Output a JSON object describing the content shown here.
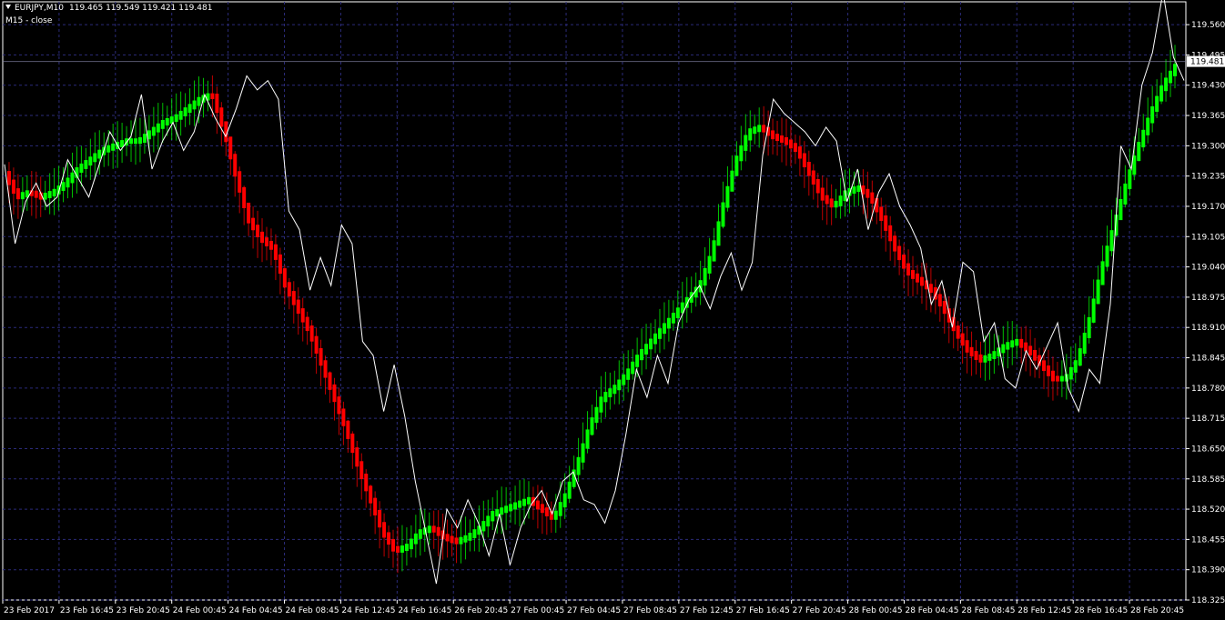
{
  "header": {
    "symbol": "EURJPY,M10",
    "quote": "119.465 119.549 119.421 119.481",
    "indicator": "M15 - close"
  },
  "colors": {
    "background": "#000000",
    "grid": "#2b2b7a",
    "axis": "#ffffff",
    "price_line": "#ffffff",
    "up": "#00ff00",
    "down": "#ff0000",
    "current_price_bg": "#ffffff",
    "current_price_text": "#000000"
  },
  "chart_data": {
    "type": "line",
    "grid": true,
    "current_price": "119.481",
    "ylim": [
      118.325,
      119.609
    ],
    "y_ticks": [
      "119.560",
      "119.495",
      "119.430",
      "119.365",
      "119.300",
      "119.235",
      "119.170",
      "119.105",
      "119.040",
      "118.975",
      "118.910",
      "118.845",
      "118.780",
      "118.715",
      "118.650",
      "118.585",
      "118.520",
      "118.455",
      "118.390",
      "118.325"
    ],
    "x_ticks": [
      "23 Feb 2017",
      "23 Feb 16:45",
      "23 Feb 20:45",
      "24 Feb 00:45",
      "24 Feb 04:45",
      "24 Feb 08:45",
      "24 Feb 12:45",
      "24 Feb 16:45",
      "26 Feb 20:45",
      "27 Feb 00:45",
      "27 Feb 04:45",
      "27 Feb 08:45",
      "27 Feb 12:45",
      "27 Feb 16:45",
      "27 Feb 20:45",
      "28 Feb 00:45",
      "28 Feb 04:45",
      "28 Feb 08:45",
      "28 Feb 12:45",
      "28 Feb 16:45",
      "28 Feb 20:45"
    ],
    "series": [
      {
        "role": "close",
        "values": [
          119.26,
          119.09,
          119.18,
          119.22,
          119.17,
          119.19,
          119.27,
          119.23,
          119.19,
          119.26,
          119.33,
          119.29,
          119.32,
          119.41,
          119.25,
          119.31,
          119.35,
          119.29,
          119.33,
          119.41,
          119.36,
          119.32,
          119.38,
          119.45,
          119.42,
          119.44,
          119.4,
          119.16,
          119.12,
          118.99,
          119.06,
          119.0,
          119.13,
          119.09,
          118.88,
          118.85,
          118.73,
          118.83,
          118.72,
          118.58,
          118.47,
          118.36,
          118.52,
          118.48,
          118.54,
          118.49,
          118.42,
          118.51,
          118.4,
          118.48,
          118.53,
          118.56,
          118.51,
          118.58,
          118.6,
          118.54,
          118.53,
          118.49,
          118.56,
          118.68,
          118.82,
          118.76,
          118.85,
          118.79,
          118.92,
          118.97,
          119.0,
          118.95,
          119.02,
          119.07,
          118.99,
          119.05,
          119.28,
          119.4,
          119.37,
          119.35,
          119.33,
          119.3,
          119.34,
          119.31,
          119.18,
          119.25,
          119.12,
          119.2,
          119.24,
          119.17,
          119.13,
          119.08,
          118.96,
          119.01,
          118.91,
          119.05,
          119.03,
          118.88,
          118.92,
          118.8,
          118.78,
          118.86,
          118.82,
          118.87,
          118.92,
          118.78,
          118.73,
          118.82,
          118.79,
          118.96,
          119.3,
          119.25,
          119.43,
          119.5,
          119.63,
          119.49,
          119.44
        ]
      },
      {
        "role": "smoothed",
        "values": [
          119.24,
          119.19,
          119.2,
          119.19,
          119.2,
          119.22,
          119.25,
          119.27,
          119.29,
          119.3,
          119.31,
          119.31,
          119.33,
          119.35,
          119.36,
          119.38,
          119.4,
          119.41,
          119.33,
          119.23,
          119.14,
          119.1,
          119.08,
          119.0,
          118.95,
          118.9,
          118.83,
          118.76,
          118.69,
          118.61,
          118.54,
          118.47,
          118.43,
          118.44,
          118.47,
          118.48,
          118.46,
          118.45,
          118.46,
          118.48,
          118.51,
          118.52,
          118.53,
          118.54,
          118.52,
          118.5,
          118.55,
          118.62,
          118.7,
          118.76,
          118.78,
          118.81,
          118.85,
          118.88,
          118.91,
          118.94,
          118.97,
          119.0,
          119.07,
          119.18,
          119.27,
          119.33,
          119.34,
          119.32,
          119.31,
          119.29,
          119.24,
          119.19,
          119.17,
          119.2,
          119.21,
          119.19,
          119.14,
          119.08,
          119.03,
          119.01,
          118.99,
          118.95,
          118.9,
          118.86,
          118.84,
          118.85,
          118.87,
          118.88,
          118.86,
          118.83,
          118.8,
          118.8,
          118.84,
          118.93,
          119.04,
          119.13,
          119.22,
          119.3,
          119.37,
          119.43,
          119.47
        ],
        "up_color": "green",
        "down_color": "red"
      }
    ]
  }
}
